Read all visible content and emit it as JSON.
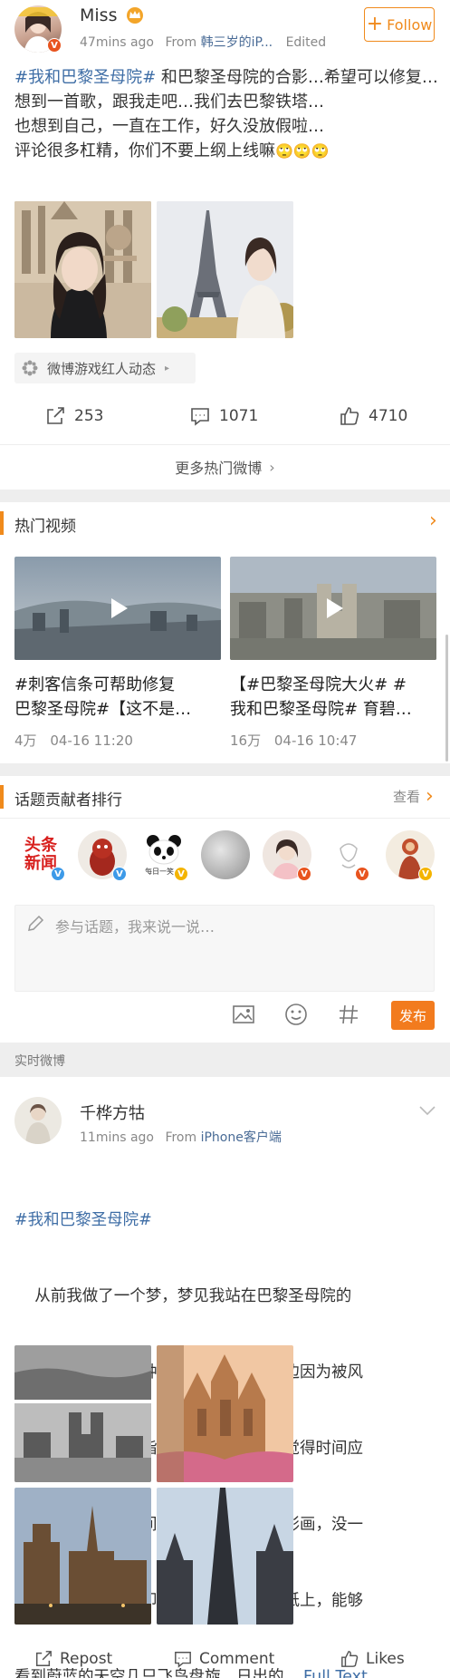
{
  "post1": {
    "username": "Miss",
    "time": "47mins ago",
    "from_prefix": "From",
    "source": "韩三岁的iP...",
    "edited": "Edited",
    "follow_label": "Follow",
    "topic": "#我和巴黎圣母院#",
    "text_line1": " 和巴黎圣母院的合影…希望可以修复…",
    "text_line2": "想到一首歌，跟我走吧…我们去巴黎铁塔…",
    "text_line3": "也想到自己，一直在工作，好久没放假啦…",
    "text_line4": "评论很多杠精，你们不要上纲上线嘛",
    "emoji": "🙄🙄🙄",
    "tag_label": "微博游戏红人动态",
    "reposts": "253",
    "comments": "1071",
    "likes": "4710",
    "more_label": "更多热门微博"
  },
  "hot_videos": {
    "title": "热门视频",
    "items": [
      {
        "caption1": "#刺客信条可帮助修复",
        "caption2": "巴黎圣母院#【这不是…",
        "views": "4万",
        "date": "04-16 11:20"
      },
      {
        "caption1": "【#巴黎圣母院大火# #",
        "caption2": "我和巴黎圣母院# 育碧…",
        "views": "16万",
        "date": "04-16 10:47"
      }
    ]
  },
  "ranking": {
    "title": "话题贡献者排行",
    "view_label": "查看",
    "first_avatar_text": "头条新闻",
    "panda_text": "每日一笑"
  },
  "composer": {
    "placeholder": "参与话题，我来说一说…",
    "publish_label": "发布"
  },
  "realtime": {
    "title": "实时微博"
  },
  "post2": {
    "username": "千桦方牯",
    "time": "11mins ago",
    "from_prefix": "From",
    "source": "iPhone客户端",
    "topic": "#我和巴黎圣母院#",
    "lines": [
      "    从前我做了一个梦，梦见我站在巴黎圣母院的",
      "楼上，听着远处的钟声悠长的响起，耳边因为被风",
      "吹散的头发，用手指轻轻的打理着，总觉得时间应",
      "该就定格在这一瞬间，像画家笔下的油彩画，没一",
      "点细节都很细腻的印在那一副白色的画纸上，能够",
      "看到蔚蓝的天空几只飞鸟盘旋，日出的…"
    ],
    "full_text": "Full Text",
    "repost_label": "Repost",
    "comment_label": "Comment",
    "likes_label": "Likes"
  }
}
